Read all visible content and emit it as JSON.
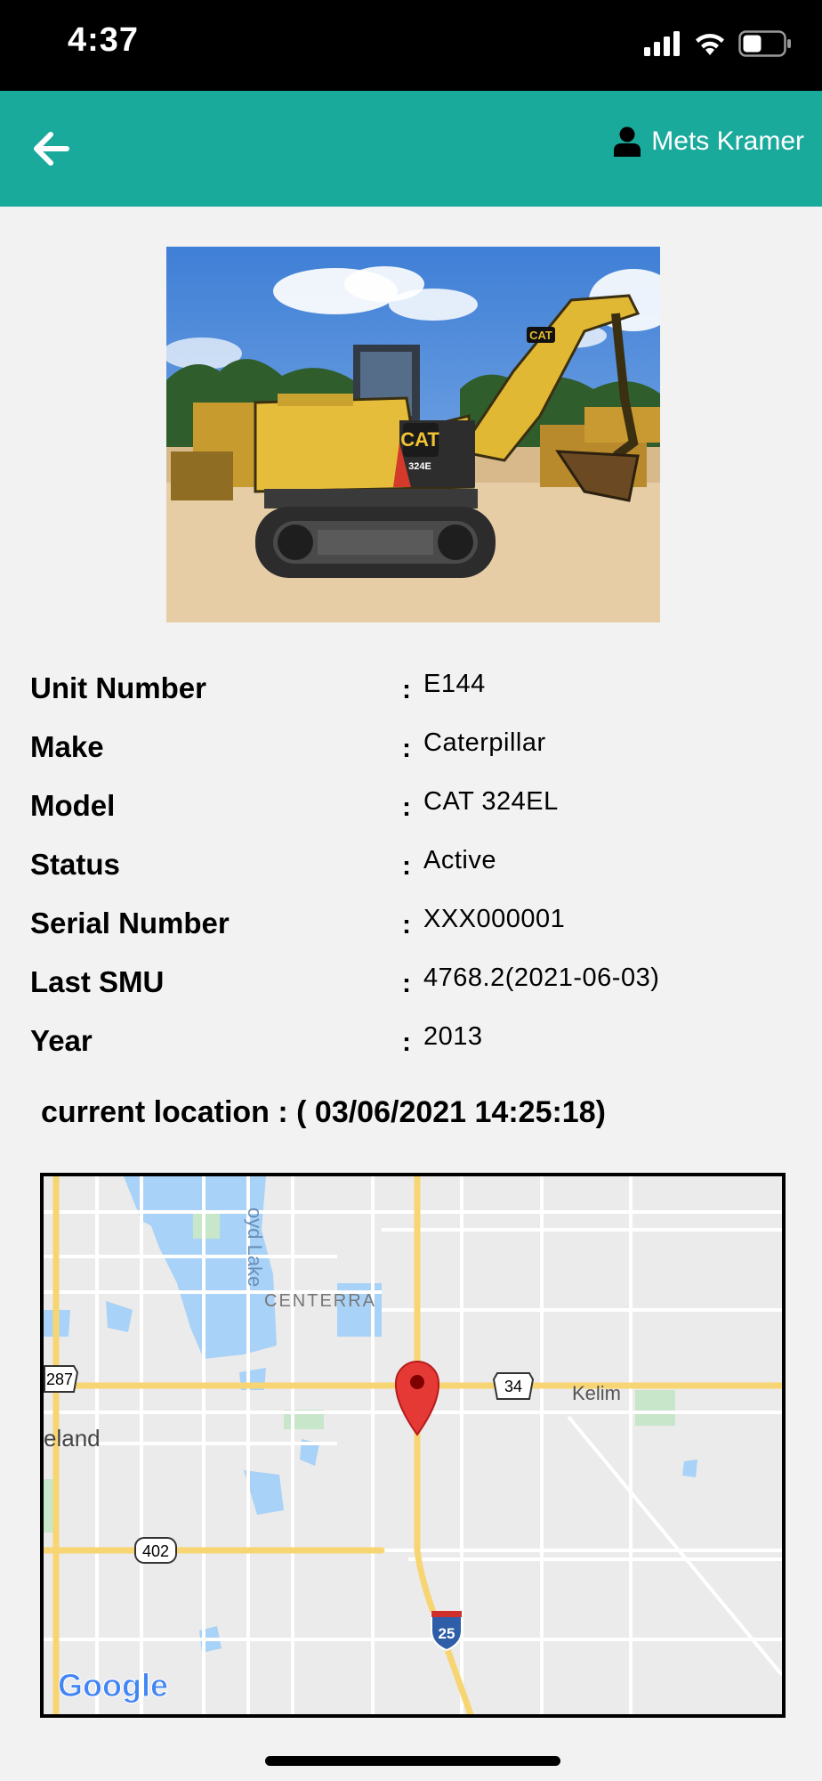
{
  "status_bar": {
    "time": "4:37"
  },
  "header": {
    "back_icon": "arrow-left-icon",
    "user_icon": "person-icon",
    "user_name": "Mets Kramer"
  },
  "equipment_photo": {
    "badge_text": "CAT",
    "model_tag": "324E"
  },
  "details": [
    {
      "label": "Unit Number",
      "value": "E144"
    },
    {
      "label": "Make",
      "value": "Caterpillar"
    },
    {
      "label": "Model",
      "value": "CAT 324EL"
    },
    {
      "label": "Status",
      "value": "Active"
    },
    {
      "label": "Serial Number",
      "value": "XXX000001"
    },
    {
      "label": "Last SMU",
      "value": "4768.2(2021-06-03)"
    },
    {
      "label": "Year",
      "value": "2013"
    }
  ],
  "separator": ":",
  "location": {
    "title": "current location : ( 03/06/2021 14:25:18)"
  },
  "map": {
    "labels": {
      "lake": "oyd Lake",
      "area1": "CENTERRA",
      "town1": "Kelim",
      "town2": "eland"
    },
    "shields": {
      "us287": "287",
      "us34": "34",
      "r402": "402",
      "i25": "25"
    },
    "attribution": "Google",
    "pin_color": "#e53935"
  },
  "colors": {
    "app_bar": "#1aaa9c",
    "background": "#f2f2f2"
  }
}
